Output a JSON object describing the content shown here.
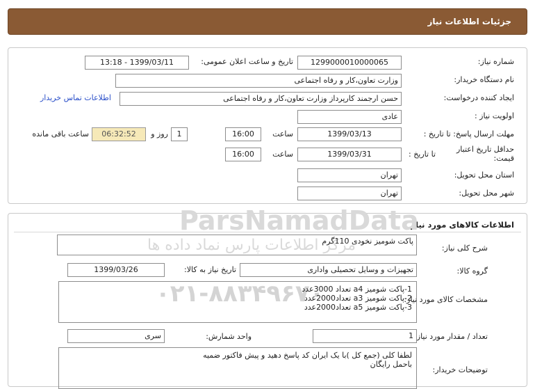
{
  "header": {
    "title": "جزئیات اطلاعات نیاز"
  },
  "need": {
    "need_number_label": "شماره نیاز:",
    "need_number": "1299000010000065",
    "announce_label": "تاریخ و ساعت اعلان عمومی:",
    "announce_value": "1399/03/11 - 13:18",
    "buyer_label": "نام دستگاه خریدار:",
    "buyer_value": "وزارت تعاون،کار و رفاه اجتماعی",
    "creator_label": "ایجاد کننده درخواست:",
    "creator_value": "حسن ارجمند کارپرداز وزارت تعاون،کار و رفاه اجتماعی",
    "contact_link": "اطلاعات تماس خریدار",
    "priority_label": "اولویت نیاز :",
    "priority_value": "عادی",
    "deadline_label": "مهلت ارسال پاسخ: تا تاریخ :",
    "deadline_date": "1399/03/13",
    "time_label": "ساعت",
    "deadline_time": "16:00",
    "days_value": "1",
    "days_label": "روز و",
    "remaining_value": "06:32:52",
    "remaining_label": "ساعت باقی مانده",
    "validity_label": "حداقل تاریخ اعتبار قیمت:",
    "validity_to_label": "تا تاریخ :",
    "validity_date": "1399/03/31",
    "validity_time_label": "ساعت",
    "validity_time": "16:00",
    "province_label": "استان محل تحویل:",
    "province_value": "تهران",
    "city_label": "شهر محل تحویل:",
    "city_value": "تهران"
  },
  "goods": {
    "section_title": "اطلاعات کالاهای مورد نیاز",
    "desc_label": "شرح کلی نیاز:",
    "desc_value": "پاکت شومیز نخودی 110گرم",
    "group_label": "گروه کالا:",
    "group_value": "تجهیزات و وسایل تحصیلی واداری",
    "need_date_label": "تاریخ نیاز به کالا:",
    "need_date_value": "1399/03/26",
    "spec_label": "مشخصات کالای مورد نیاز:",
    "spec_lines": "1-پاکت شومیز a4    تعداد  3000عدد\n2-پاکت شومیز a3     تعداد2000عدد\n3-پاکت شومیز a5     تعداد2000عدد",
    "qty_label": "تعداد / مقدار مورد نیاز:",
    "qty_value": "1",
    "unit_label": "واحد شمارش:",
    "unit_value": "سری",
    "notes_label": "توضیحات خریدار:",
    "notes_value": "لطفا کلی (جمع کل )با یک ایران کد پاسخ دهید و پیش فاکتور ضمیه\nباحمل رایگان"
  },
  "watermark": {
    "brand": "ParsNamadData",
    "slogan": "مرکز اطلاعات پارس نماد داده ها",
    "phone": "۰۲۱-۸۸۳۴۹۶۷۰"
  }
}
